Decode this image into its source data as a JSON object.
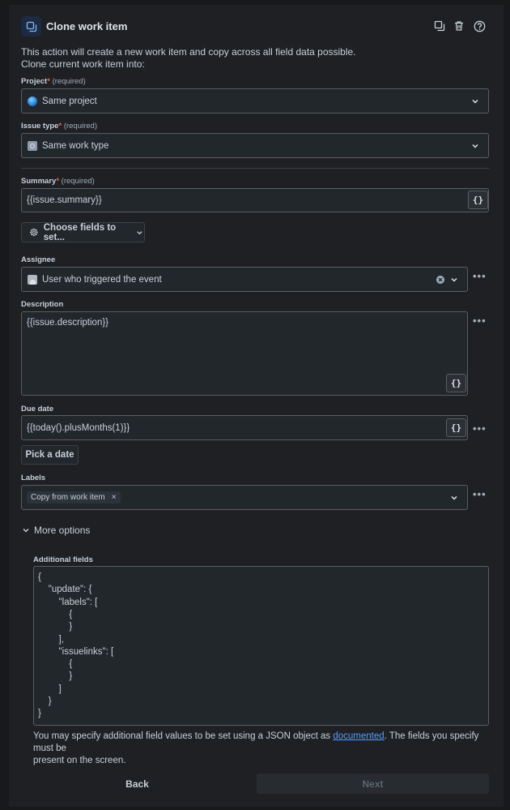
{
  "header": {
    "title": "Clone work item"
  },
  "intro": {
    "line1": "This action will create a new work item and copy across all field data possible.",
    "line2": "Clone current work item into:"
  },
  "project": {
    "label": "Project",
    "required": "(required)",
    "value": "Same project"
  },
  "issue_type": {
    "label": "Issue type",
    "required": "(required)",
    "value": "Same work type"
  },
  "summary": {
    "label": "Summary",
    "required": "(required)",
    "value": "{{issue.summary}}"
  },
  "choose_fields": {
    "label": "Choose fields to set..."
  },
  "assignee": {
    "label": "Assignee",
    "value": "User who triggered the event"
  },
  "description": {
    "label": "Description",
    "value": "{{issue.description}}"
  },
  "due_date": {
    "label": "Due date",
    "value": "{{today().plusMonths(1)}}",
    "pick_label": "Pick a date"
  },
  "labels": {
    "label": "Labels",
    "tag": "Copy from work item"
  },
  "more_options": {
    "label": "More options"
  },
  "additional_fields": {
    "label": "Additional fields",
    "lines": [
      "{",
      "    \"update\": {",
      "        \"labels\": [",
      "            {",
      "            }",
      "        ],",
      "        \"issuelinks\": [",
      "            {",
      "            }",
      "        ]",
      "    }",
      "}"
    ],
    "help_before": "You may specify additional field values to be set using a JSON object as ",
    "help_link": "documented",
    "help_after": ". The fields you specify must be",
    "help_line2": "present on the screen."
  },
  "footer": {
    "back_label": "Back",
    "next_label": "Next"
  },
  "colors": {
    "background": "#1f2023",
    "accent": "#579dff",
    "required_star": "#f15b50"
  }
}
